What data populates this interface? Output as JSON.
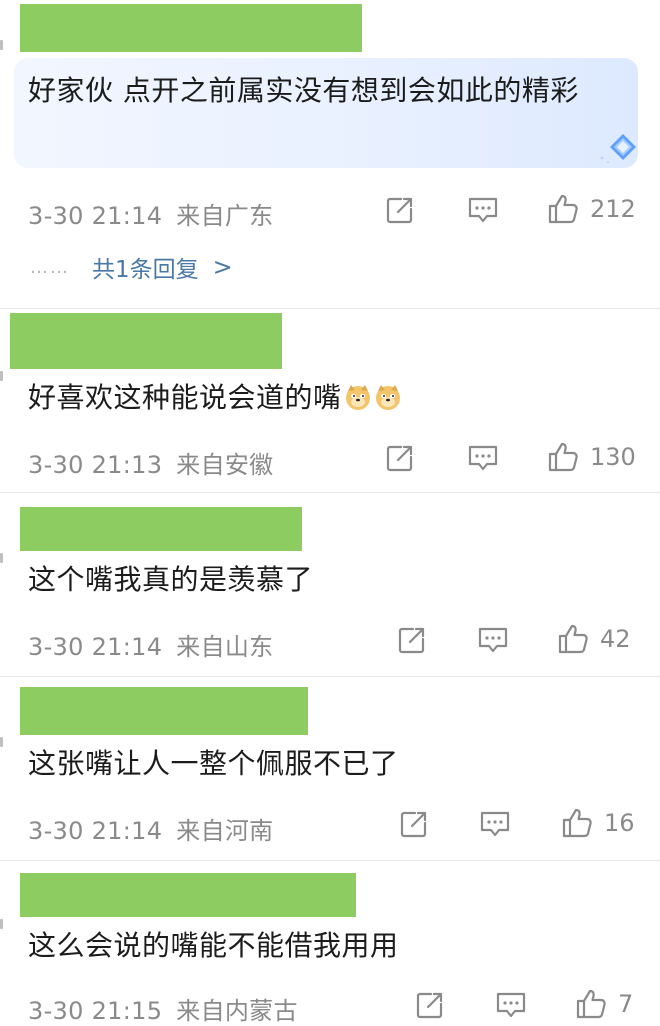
{
  "comments": [
    {
      "text": "好家伙 点开之前属实没有想到会如此的精彩",
      "time": "3-30 21:14",
      "location": "来自广东",
      "likes": "212",
      "replies_label": "共1条回复",
      "reply_dots": "……",
      "reply_chevron": ">"
    },
    {
      "text": "好喜欢这种能说会道的嘴",
      "emojis": [
        "doge-emoji",
        "doge-emoji"
      ],
      "time": "3-30 21:13",
      "location": "来自安徽",
      "likes": "130"
    },
    {
      "text": "这个嘴我真的是羡慕了",
      "time": "3-30 21:14",
      "location": "来自山东",
      "likes": "42"
    },
    {
      "text": "这张嘴让人一整个佩服不已了",
      "time": "3-30 21:14",
      "location": "来自河南",
      "likes": "16"
    },
    {
      "text": "这么会说的嘴能不能借我用用",
      "time": "3-30 21:15",
      "location": "来自内蒙古",
      "likes": "7"
    }
  ],
  "colors": {
    "redaction": "#8dcc61",
    "meta": "#8a8a8a",
    "link": "#4a78a8",
    "highlight": "#e9f1ff"
  },
  "icons": [
    "share-icon",
    "comment-icon",
    "like-icon",
    "diamond-badge-icon"
  ]
}
